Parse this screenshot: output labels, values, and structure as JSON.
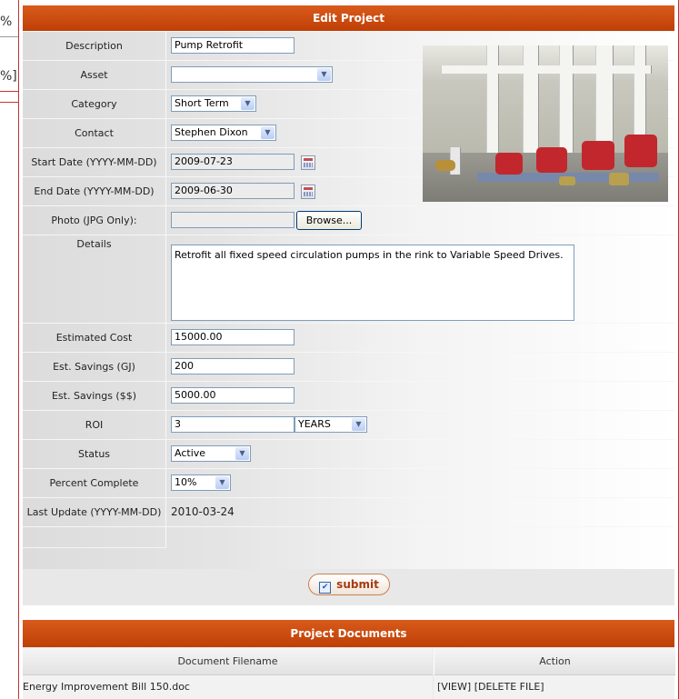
{
  "background_fragments": [
    "%",
    "%]"
  ],
  "form": {
    "title": "Edit Project",
    "fields": {
      "description": {
        "label": "Description",
        "value": "Pump Retrofit"
      },
      "asset": {
        "label": "Asset",
        "value": ""
      },
      "category": {
        "label": "Category",
        "value": "Short Term"
      },
      "contact": {
        "label": "Contact",
        "value": "Stephen Dixon"
      },
      "start_date": {
        "label": "Start Date (YYYY-MM-DD)",
        "value": "2009-07-23"
      },
      "end_date": {
        "label": "End Date (YYYY-MM-DD)",
        "value": "2009-06-30"
      },
      "photo": {
        "label": "Photo (JPG Only):",
        "value": "",
        "browse_label": "Browse..."
      },
      "details": {
        "label": "Details",
        "value": "Retrofit all fixed speed circulation pumps in the rink to Variable Speed Drives."
      },
      "estimated_cost": {
        "label": "Estimated Cost",
        "value": "15000.00"
      },
      "savings_gj": {
        "label": "Est. Savings (GJ)",
        "value": "200"
      },
      "savings_dollars": {
        "label": "Est. Savings ($$)",
        "value": "5000.00"
      },
      "roi": {
        "label": "ROI",
        "value": "3",
        "unit": "YEARS"
      },
      "status": {
        "label": "Status",
        "value": "Active"
      },
      "percent_complete": {
        "label": "Percent Complete",
        "value": "10%"
      },
      "last_update": {
        "label": "Last Update (YYYY-MM-DD)",
        "value": "2010-03-24"
      }
    },
    "submit_label": "submit"
  },
  "documents": {
    "title": "Project Documents",
    "columns": [
      "Document Filename",
      "Action"
    ],
    "rows": [
      {
        "filename": "Energy Improvement Bill 150.doc",
        "view": "[VIEW]",
        "delete": "[DELETE FILE]"
      }
    ]
  },
  "colors": {
    "title_bar": "#c84a0e",
    "panel_border": "#bb3333",
    "input_border": "#7f9db9",
    "submit_text": "#a83a10"
  }
}
